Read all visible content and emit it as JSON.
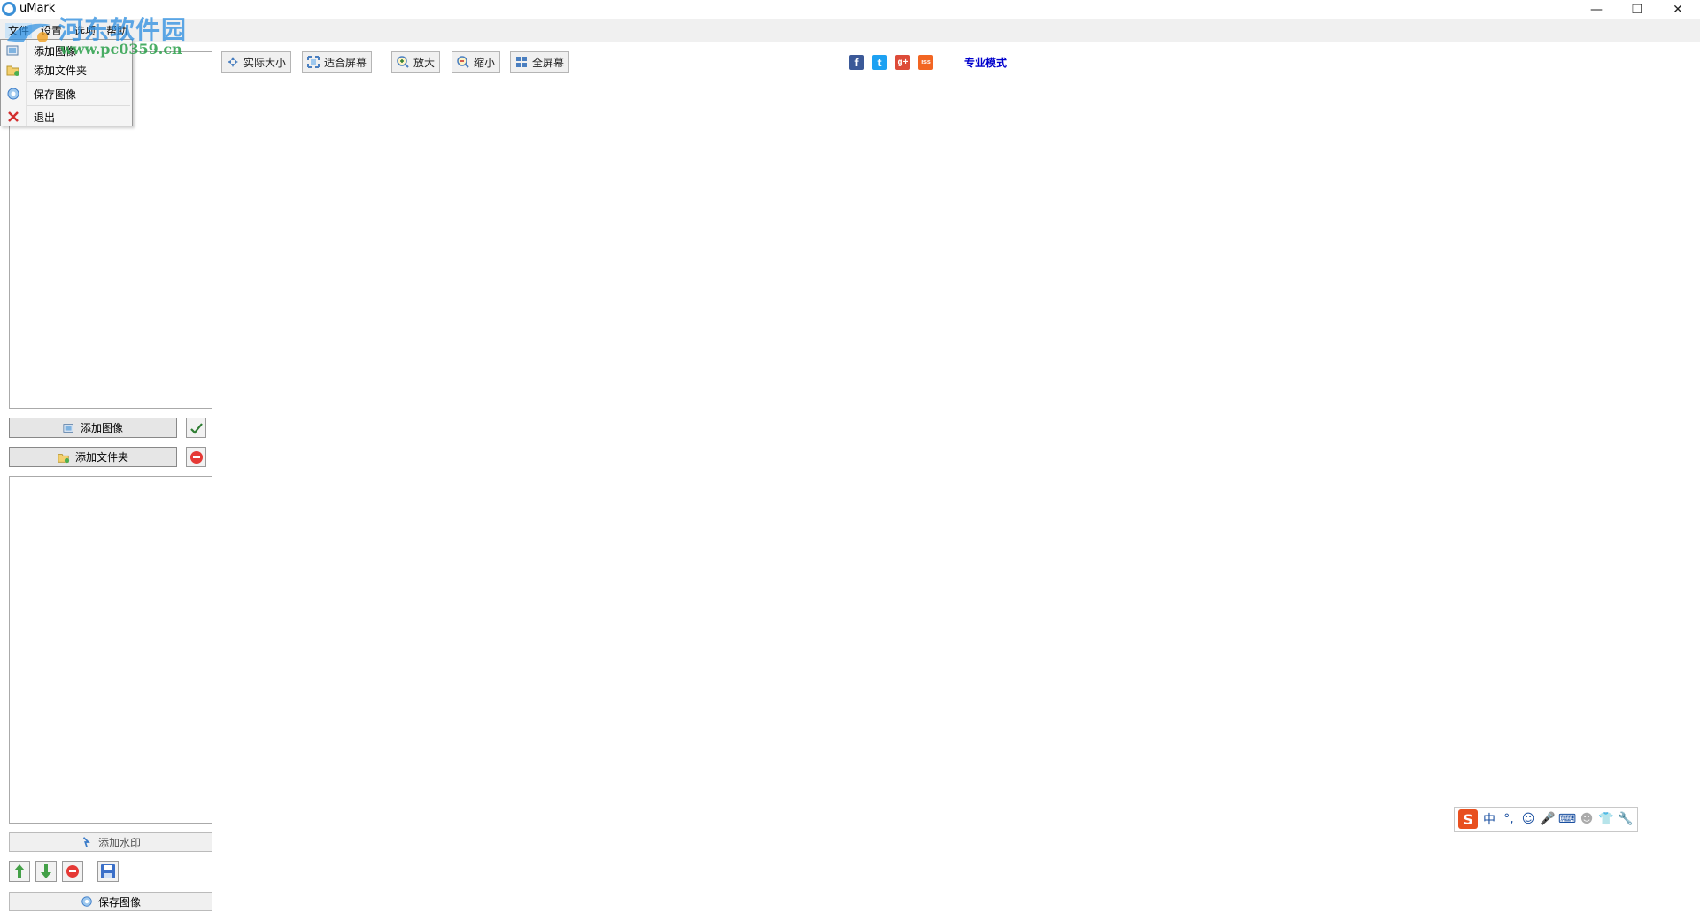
{
  "window": {
    "title": "uMark",
    "controls": {
      "minimize": "—",
      "restore": "❐",
      "close": "✕"
    }
  },
  "watermark": {
    "text": "河东软件园",
    "url": "www.pc0359.cn"
  },
  "menubar": {
    "items": [
      {
        "label": "文件"
      },
      {
        "label": "设置"
      },
      {
        "label": "选项"
      },
      {
        "label": "帮助"
      }
    ]
  },
  "dropdown": {
    "items": [
      {
        "label": "添加图像",
        "icon": "add-image-icon"
      },
      {
        "label": "添加文件夹",
        "icon": "add-folder-icon"
      },
      {
        "label": "保存图像",
        "icon": "save-image-icon"
      },
      {
        "label": "退出",
        "icon": "exit-icon"
      }
    ]
  },
  "left_panel": {
    "add_image": "添加图像",
    "add_folder": "添加文件夹",
    "add_watermark": "添加水印",
    "save_image": "保存图像"
  },
  "toolbar": {
    "actual_size": "实际大小",
    "fit_screen": "适合屏幕",
    "zoom_in": "放大",
    "zoom_out": "缩小",
    "fullscreen": "全屏幕"
  },
  "social": {
    "facebook": "f",
    "twitter": "t",
    "gplus": "g+",
    "rss": "rss"
  },
  "pro_mode": "专业模式",
  "ime": {
    "logo": "S",
    "lang": "中",
    "punct": "°,"
  },
  "colors": {
    "accent_blue": "#2a8de0",
    "facebook": "#3b5998",
    "twitter": "#1da1f2",
    "gplus": "#dd4b39",
    "rss": "#f26522",
    "ime_orange": "#e8501f"
  }
}
